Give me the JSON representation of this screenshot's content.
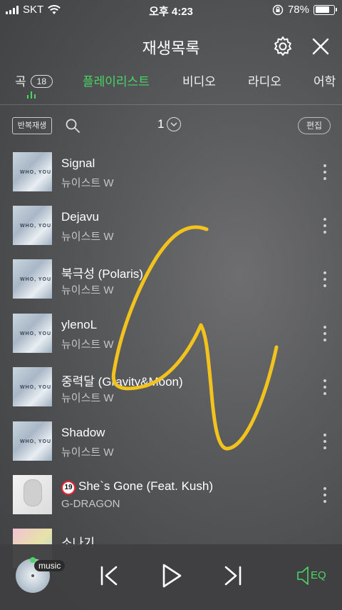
{
  "status_bar": {
    "carrier": "SKT",
    "time": "오후 4:23",
    "battery_percent": "78%",
    "battery_level": 0.78
  },
  "header": {
    "title": "재생목록",
    "settings_icon": "gear-icon",
    "close_icon": "close-icon"
  },
  "tabs": [
    {
      "label": "곡",
      "count": "18"
    },
    {
      "label": "플레이리스트",
      "active": true
    },
    {
      "label": "비디오"
    },
    {
      "label": "라디오"
    },
    {
      "label": "어학"
    }
  ],
  "toolbar": {
    "repeat_label": "반복재생",
    "page": "1",
    "edit_label": "편집"
  },
  "tracks": [
    {
      "title": "Signal",
      "artist": "뉴이스트 W",
      "art": "WHO, YOU"
    },
    {
      "title": "Dejavu",
      "artist": "뉴이스트 W",
      "art": "WHO, YOU"
    },
    {
      "title": "북극성 (Polaris)",
      "artist": "뉴이스트 W",
      "art": "WHO, YOU"
    },
    {
      "title": "ylenoL",
      "artist": "뉴이스트 W",
      "art": "WHO, YOU"
    },
    {
      "title": "중력달 (Gravity&Moon)",
      "artist": "뉴이스트 W",
      "art": "WHO, YOU"
    },
    {
      "title": "Shadow",
      "artist": "뉴이스트 W",
      "art": "WHO, YOU"
    },
    {
      "title": "She`s Gone (Feat. Kush)",
      "artist": "G-DRAGON",
      "age_badge": "19"
    },
    {
      "title": "소나기",
      "artist": ""
    }
  ],
  "player": {
    "badge": "music",
    "eq_label": "EQ"
  },
  "colors": {
    "accent": "#49d665",
    "scribble": "#f2c21d"
  }
}
